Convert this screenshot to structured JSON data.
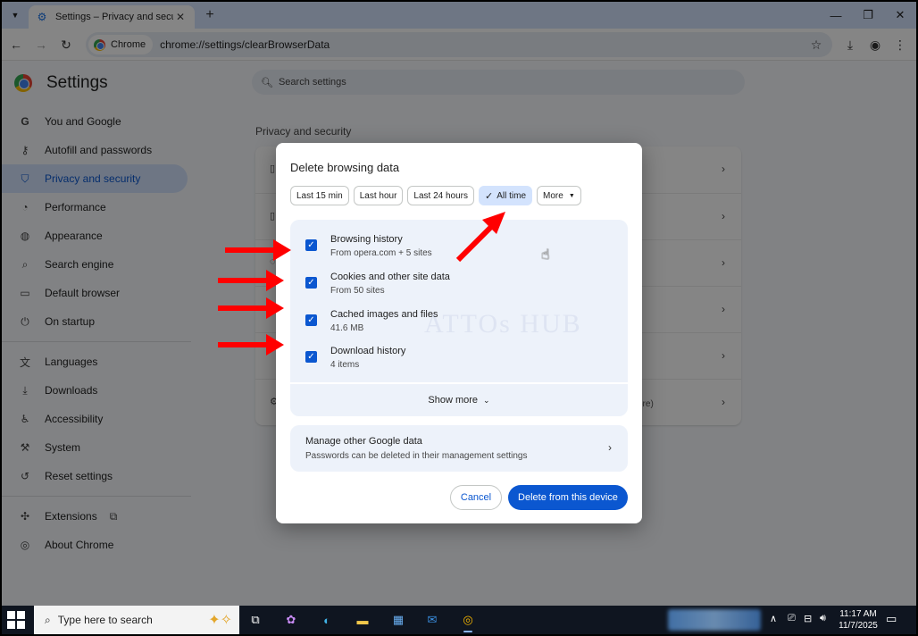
{
  "browser": {
    "tab_title": "Settings – Privacy and security",
    "url": "chrome://settings/clearBrowserData",
    "site_chip": "Chrome"
  },
  "settings": {
    "title": "Settings",
    "search_placeholder": "Search settings",
    "section_title": "Privacy and security",
    "sidebar": [
      {
        "label": "You and Google",
        "icon": "google-g-icon"
      },
      {
        "label": "Autofill and passwords",
        "icon": "key-icon"
      },
      {
        "label": "Privacy and security",
        "icon": "shield-icon",
        "active": true
      },
      {
        "label": "Performance",
        "icon": "speedometer-icon"
      },
      {
        "label": "Appearance",
        "icon": "palette-icon"
      },
      {
        "label": "Search engine",
        "icon": "search-icon"
      },
      {
        "label": "Default browser",
        "icon": "browser-window-icon"
      },
      {
        "label": "On startup",
        "icon": "power-icon"
      },
      {
        "label": "Languages",
        "icon": "translate-icon"
      },
      {
        "label": "Downloads",
        "icon": "download-icon"
      },
      {
        "label": "Accessibility",
        "icon": "accessibility-icon"
      },
      {
        "label": "System",
        "icon": "wrench-icon"
      },
      {
        "label": "Reset settings",
        "icon": "reset-icon"
      },
      {
        "label": "Extensions",
        "icon": "puzzle-icon"
      },
      {
        "label": "About Chrome",
        "icon": "chrome-logo-icon"
      }
    ],
    "card_fragment": "ore)"
  },
  "dialog": {
    "title": "Delete browsing data",
    "time_ranges": [
      "Last 15 min",
      "Last hour",
      "Last 24 hours",
      "All time",
      "More"
    ],
    "selected_range": "All time",
    "items": [
      {
        "title": "Browsing history",
        "subtitle": "From opera.com + 5 sites",
        "checked": true
      },
      {
        "title": "Cookies and other site data",
        "subtitle": "From 50 sites",
        "checked": true
      },
      {
        "title": "Cached images and files",
        "subtitle": "41.6 MB",
        "checked": true
      },
      {
        "title": "Download history",
        "subtitle": "4 items",
        "checked": true
      }
    ],
    "watermark": "ATTOs HUB",
    "show_more": "Show more",
    "manage_title": "Manage other Google data",
    "manage_subtitle": "Passwords can be deleted in their management settings",
    "cancel": "Cancel",
    "delete": "Delete from this device"
  },
  "taskbar": {
    "search_placeholder": "Type here to search",
    "time": "11:17 AM",
    "date": "11/7/2025"
  },
  "colors": {
    "accent": "#0b57d0",
    "annotation_red": "#ff0000",
    "selected_chip": "#d3e3fd"
  }
}
